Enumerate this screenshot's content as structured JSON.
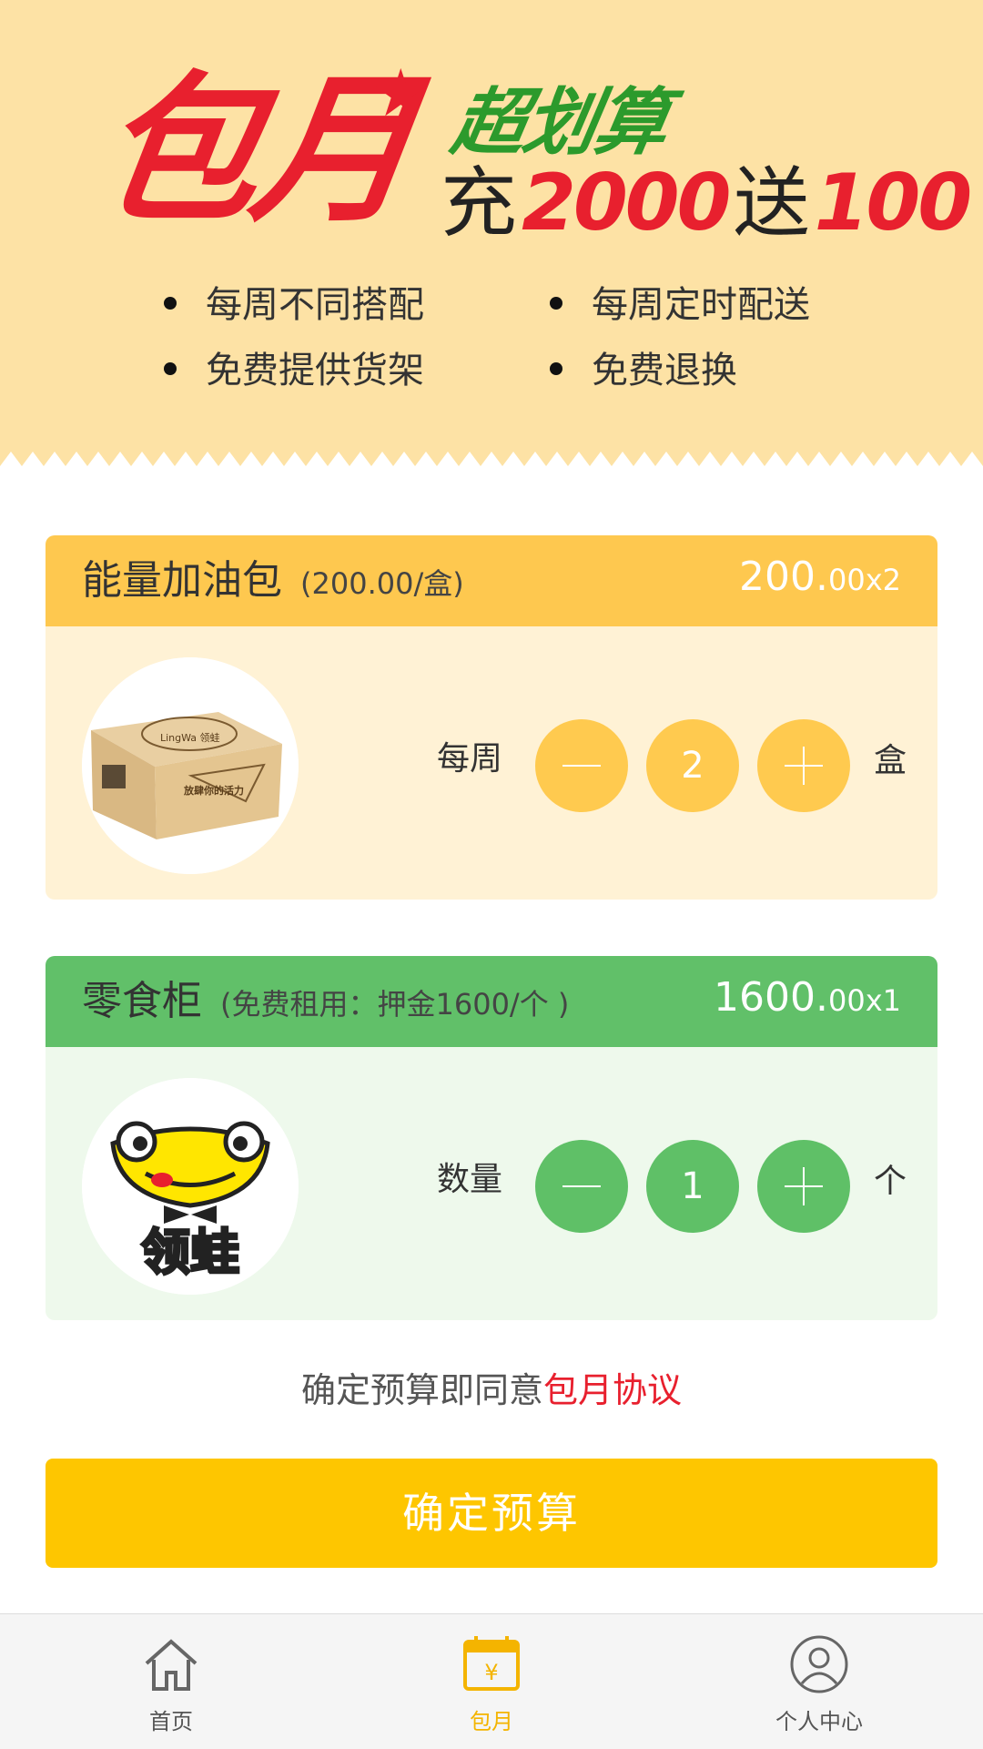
{
  "banner": {
    "logo_text": "包月",
    "tagline": "超划算",
    "promo": {
      "prefix": "充",
      "charge": "2000",
      "middle": "送",
      "bonus": "100"
    },
    "features": [
      "每周不同搭配",
      "每周定时配送",
      "免费提供货架",
      "免费退换"
    ]
  },
  "products": [
    {
      "name": "能量加油包",
      "sub": "(200.00/盒)",
      "total_main": "200.",
      "total_dec": "00",
      "total_mult": "x2",
      "qty_label": "每周",
      "quantity": "2",
      "unit": "盒",
      "image_icon": "snack-box-image",
      "box_brand": "LingWa 领蛙",
      "box_slogan": "放肆你的活力"
    },
    {
      "name": "零食柜",
      "sub": "(免费租用：押金1600/个 )",
      "total_main": "1600.",
      "total_dec": "00",
      "total_mult": "x1",
      "qty_label": "数量",
      "quantity": "1",
      "unit": "个",
      "image_icon": "frog-logo-image",
      "logo_text": "领蛙"
    }
  ],
  "agreement": {
    "prefix": "确定预算即同意",
    "link": "包月协议"
  },
  "confirm_label": "确定预算",
  "tabs": [
    {
      "label": "首页",
      "icon": "home-icon",
      "active": false
    },
    {
      "label": "包月",
      "icon": "calendar-yen-icon",
      "active": true
    },
    {
      "label": "个人中心",
      "icon": "user-icon",
      "active": false
    }
  ],
  "colors": {
    "banner_bg": "#fde2a5",
    "brand_red": "#e8202e",
    "brand_green": "#2c9a2c",
    "yellow_head": "#fec84f",
    "yellow_body": "#fff2d5",
    "green_head": "#61c069",
    "green_body": "#eef9ec",
    "confirm_bg": "#fec600",
    "tab_active": "#f4b400"
  }
}
